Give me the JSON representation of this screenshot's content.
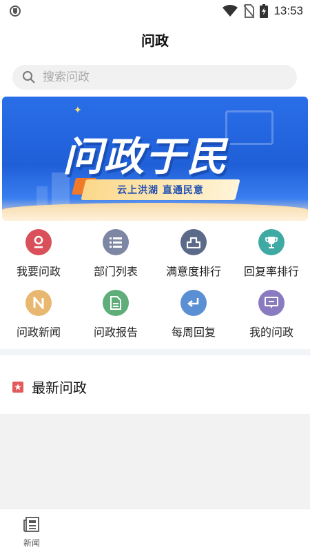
{
  "status_bar": {
    "time": "13:53"
  },
  "header": {
    "title": "问政"
  },
  "search": {
    "placeholder": "搜索问政"
  },
  "banner": {
    "headline": "问政于民",
    "tagline": "云上洪湖 直通民意"
  },
  "menu": [
    {
      "label": "我要问政",
      "icon": "pin-icon",
      "color": "#d9505a"
    },
    {
      "label": "部门列表",
      "icon": "list-icon",
      "color": "#7d87a4"
    },
    {
      "label": "满意度排行",
      "icon": "rank-icon",
      "color": "#5a6a88"
    },
    {
      "label": "回复率排行",
      "icon": "trophy-icon",
      "color": "#3fa9a4"
    },
    {
      "label": "问政新闻",
      "icon": "news-n-icon",
      "color": "#e8b770"
    },
    {
      "label": "问政报告",
      "icon": "report-icon",
      "color": "#5fae7a"
    },
    {
      "label": "每周回复",
      "icon": "reply-icon",
      "color": "#5b8fd4"
    },
    {
      "label": "我的问政",
      "icon": "chat-icon",
      "color": "#8a7bc0"
    }
  ],
  "section": {
    "title": "最新问政"
  },
  "tabbar": {
    "items": [
      {
        "label": "新闻",
        "icon": "newspaper-icon"
      }
    ]
  }
}
